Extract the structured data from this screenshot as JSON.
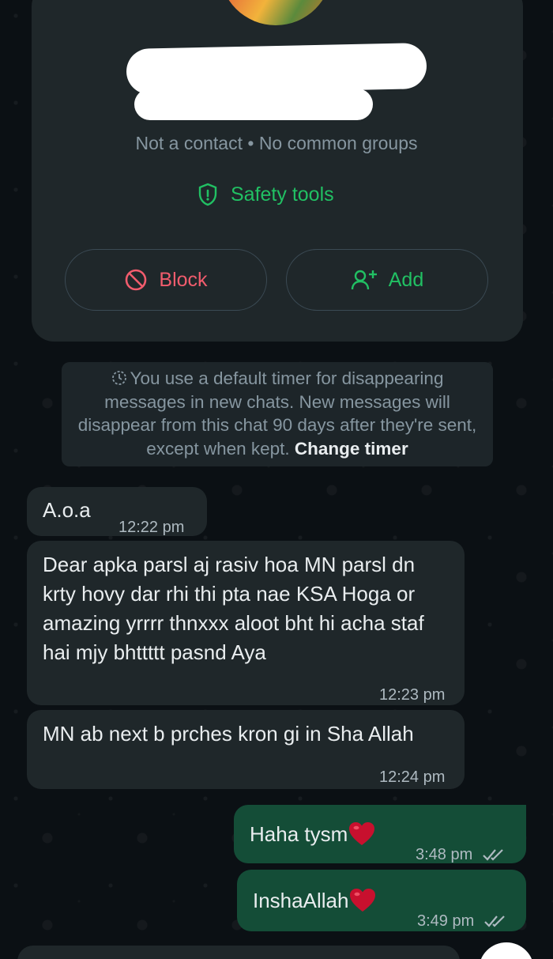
{
  "contact_card": {
    "meta_line": "Not a contact • No common groups",
    "safety_tools_label": "Safety tools",
    "block_label": "Block",
    "add_label": "Add"
  },
  "system_message": {
    "text": "You use a default timer for disappearing messages in new chats. New messages will disappear from this chat 90 days after they're sent, except when kept.",
    "link": "Change timer"
  },
  "messages": [
    {
      "direction": "incoming",
      "text": "A.o.a",
      "time": "12:22 pm"
    },
    {
      "direction": "incoming",
      "text": "Dear apka parsl aj rasiv hoa MN parsl dn krty hovy dar rhi thi pta nae KSA Hoga or amazing yrrrr thnxxx aloot bht hi acha staf hai mjy bhttttt pasnd Aya",
      "time": "12:23 pm"
    },
    {
      "direction": "incoming",
      "text": "MN ab next b prches kron gi in Sha Allah",
      "time": "12:24 pm"
    },
    {
      "direction": "outgoing",
      "text": "Haha tysm",
      "emoji": "heart",
      "time": "3:48 pm",
      "status": "read"
    },
    {
      "direction": "outgoing",
      "text": "InshaAllah",
      "emoji": "heart",
      "time": "3:49 pm",
      "status": "read"
    }
  ],
  "colors": {
    "background": "#0b1014",
    "incoming_bubble": "#1f2c34",
    "outgoing_bubble": "#144d37",
    "accent_green": "#21c063",
    "danger_red": "#f15c6d",
    "muted_text": "#8696a0"
  },
  "icons": {
    "safety": "shield-icon",
    "block": "block-icon",
    "add": "add-person-icon",
    "timer": "timer-icon",
    "read_status": "double-check-icon"
  }
}
